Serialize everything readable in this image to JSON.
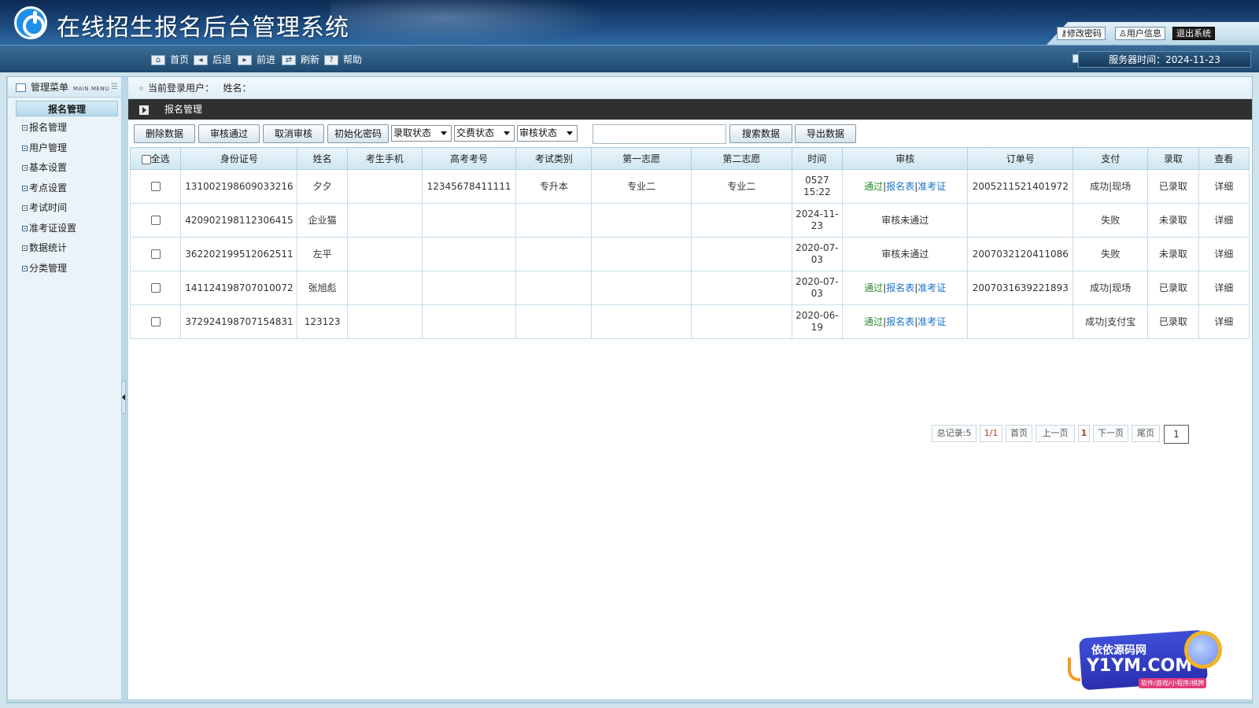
{
  "app": {
    "title": "在线招生报名后台管理系统",
    "top_actions": [
      "修改密码",
      "用户信息",
      "退出系统"
    ]
  },
  "toolbar": {
    "nav": [
      {
        "label": "首页",
        "icon": "home-icon"
      },
      {
        "label": "后退",
        "icon": "back-icon"
      },
      {
        "label": "前进",
        "icon": "forward-icon"
      },
      {
        "label": "刷新",
        "icon": "refresh-icon"
      },
      {
        "label": "帮助",
        "icon": "help-icon"
      }
    ],
    "server_time": "服务器时间：2024-11-23"
  },
  "sidebar": {
    "header": "管理菜单",
    "header_small": "MAIN MENU",
    "section": "报名管理",
    "items": [
      "报名管理",
      "用户管理",
      "基本设置",
      "考点设置",
      "考试时间",
      "准考证设置",
      "数据统计",
      "分类管理"
    ]
  },
  "main": {
    "user_label": "当前登录用户：",
    "name_label": "姓名：",
    "section_title": "报名管理",
    "buttons": {
      "delete": "删除数据",
      "approve": "审核通过",
      "cancel_audit": "取消审核",
      "reset_pwd": "初始化密码",
      "search": "搜索数据",
      "export": "导出数据"
    },
    "filters": {
      "admission": "录取状态",
      "payment": "交费状态",
      "audit": "审核状态"
    },
    "search_value": ""
  },
  "table": {
    "headers": [
      "全选",
      "身份证号",
      "姓名",
      "考生手机",
      "高考考号",
      "考试类别",
      "第一志愿",
      "第二志愿",
      "时间",
      "审核",
      "订单号",
      "支付",
      "录取",
      "查看"
    ],
    "rows": [
      {
        "id": "131002198609033216",
        "name": "夕夕",
        "phone": "",
        "exam_no": "12345678411111",
        "category": "专升本",
        "first": "专业二",
        "second": "专业二",
        "time": "0527\n15:22",
        "audit": "通过|报名表|准考证",
        "audit_ok": true,
        "order": "2005211521401972",
        "pay": "成功|现场",
        "pay_ok": true,
        "admit": "已录取",
        "admit_ok": true,
        "view": "详细"
      },
      {
        "id": "420902198112306415",
        "name": "企业猫",
        "phone": "",
        "exam_no": "",
        "category": "",
        "first": "",
        "second": "",
        "time": "2024-11-\n23",
        "audit": "审核未通过",
        "audit_ok": false,
        "order": "",
        "pay": "失败",
        "pay_ok": false,
        "admit": "未录取",
        "admit_ok": false,
        "view": "详细"
      },
      {
        "id": "362202199512062511",
        "name": "左平",
        "phone": "",
        "exam_no": "",
        "category": "",
        "first": "",
        "second": "",
        "time": "2020-07-\n03",
        "audit": "审核未通过",
        "audit_ok": false,
        "order": "2007032120411086",
        "pay": "失败",
        "pay_ok": false,
        "admit": "未录取",
        "admit_ok": false,
        "view": "详细"
      },
      {
        "id": "141124198707010072",
        "name": "张旭彪",
        "phone": "",
        "exam_no": "",
        "category": "",
        "first": "",
        "second": "",
        "time": "2020-07-\n03",
        "audit": "通过|报名表|准考证",
        "audit_ok": true,
        "order": "2007031639221893",
        "pay": "成功|现场",
        "pay_ok": true,
        "admit": "已录取",
        "admit_ok": true,
        "view": "详细"
      },
      {
        "id": "372924198707154831",
        "name": "123123",
        "phone": "",
        "exam_no": "",
        "category": "",
        "first": "",
        "second": "",
        "time": "2020-06-\n19",
        "audit": "通过|报名表|准考证",
        "audit_ok": true,
        "order": "",
        "pay": "成功|支付宝",
        "pay_ok": true,
        "admit": "已录取",
        "admit_ok": true,
        "view": "详细"
      }
    ]
  },
  "pager": {
    "total": "总记录:5",
    "pages": "1/1",
    "first": "首页",
    "prev": "上一页",
    "current": "1",
    "next": "下一页",
    "last": "尾页",
    "input": "1"
  },
  "watermark": {
    "line1": "依依源码网",
    "line2": "Y1YM.COM",
    "line3": "软件/游戏/小程序/棋牌"
  },
  "colors": {
    "header_dark": "#0d2a52",
    "toolbar": "#1f4a70",
    "ok_green": "#2e8b2e",
    "link_blue": "#1a73c8",
    "fail_red": "#c0392b"
  }
}
